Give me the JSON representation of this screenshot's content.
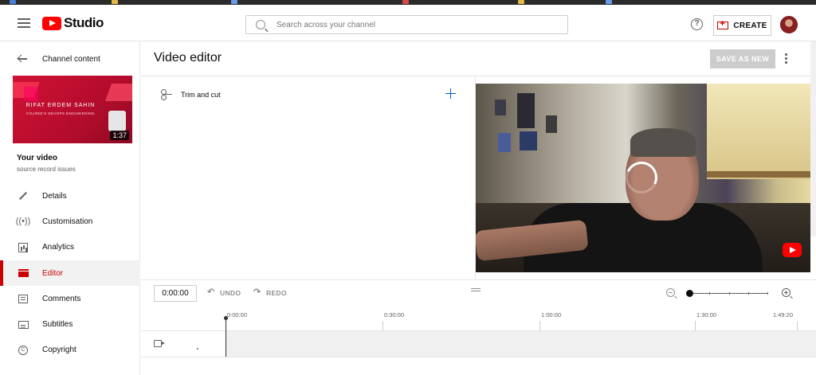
{
  "app": {
    "logo_text": "Studio",
    "search": {
      "placeholder": "Search across your channel",
      "value": ""
    },
    "help_icon": "help-circle-icon",
    "create_label": "CREATE",
    "brand_color": "#ff0000",
    "accent_color": "#065fd4"
  },
  "sidebar": {
    "back_label": "Channel content",
    "thumbnail": {
      "title_text": "RIFAT ERDEM SAHIN",
      "subtitle_text": "COLREE'S DEVOPS ENGINEERING",
      "duration": "1:37"
    },
    "your_video_label": "Your video",
    "video_subtitle": "source record issues",
    "items": [
      {
        "label": "Details",
        "icon": "pencil-icon",
        "active": false
      },
      {
        "label": "Customisation",
        "icon": "broadcast-icon",
        "active": false
      },
      {
        "label": "Analytics",
        "icon": "analytics-icon",
        "active": false
      },
      {
        "label": "Editor",
        "icon": "clapperboard-icon",
        "active": true
      },
      {
        "label": "Comments",
        "icon": "comment-icon",
        "active": false
      },
      {
        "label": "Subtitles",
        "icon": "subtitles-icon",
        "active": false
      },
      {
        "label": "Copyright",
        "icon": "copyright-icon",
        "active": false
      }
    ]
  },
  "editor": {
    "title": "Video editor",
    "save_label": "SAVE AS NEW",
    "trim_label": "Trim and cut",
    "timecode": "0:00:00",
    "undo_label": "UNDO",
    "redo_label": "REDO",
    "ruler_labels": [
      "0:00:00",
      "0:30:00",
      "1:00:00",
      "1:30:00",
      "1:49:20"
    ],
    "zoom_level": 0.0
  }
}
